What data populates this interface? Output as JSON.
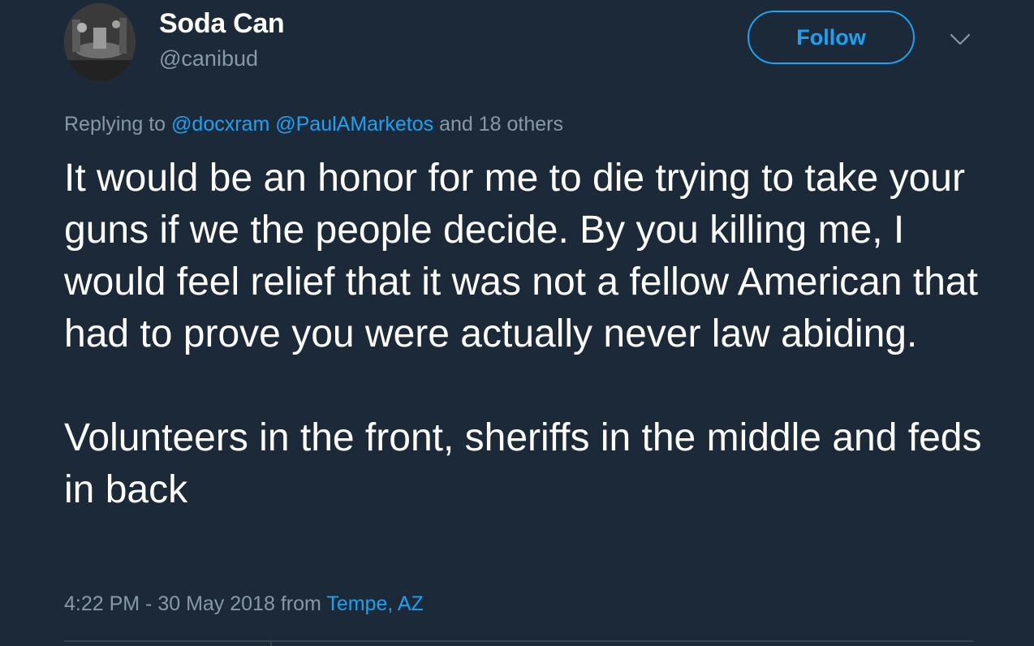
{
  "user": {
    "display_name": "Soda Can",
    "handle": "@canibud"
  },
  "actions": {
    "follow_label": "Follow",
    "more_icon": "chevron-down-icon"
  },
  "reply": {
    "prefix": "Replying to",
    "mentions": [
      "@docxram",
      "@PaulAMarketos"
    ],
    "suffix": "and 18 others"
  },
  "tweet": {
    "paragraph_1": "It would be an honor for me to die trying to take your guns if we the people decide. By you killing me, I would feel relief that it was not a fellow American that had to prove you were actually never law abiding.",
    "paragraph_2": "Volunteers in the front, sheriffs in the middle and feds in back"
  },
  "meta": {
    "timestamp": "4:22 PM - 30 May 2018",
    "from_label": "from",
    "location": "Tempe, AZ"
  },
  "colors": {
    "background": "#1c2938",
    "accent": "#1da1f2",
    "muted": "#8899a6"
  }
}
